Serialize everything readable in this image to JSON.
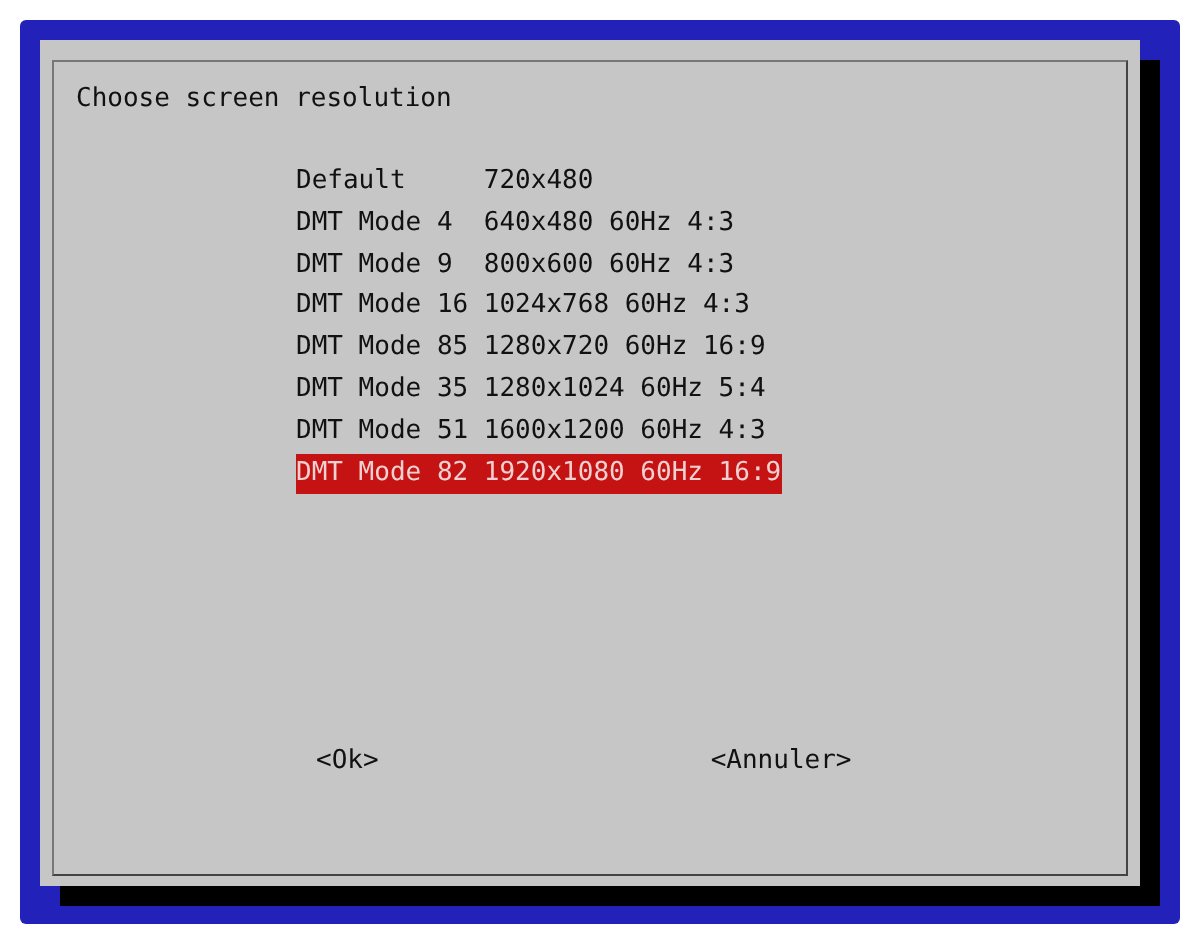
{
  "dialog": {
    "title": "Choose screen resolution",
    "items": [
      {
        "tag": "Default",
        "description": "720x480",
        "selected": false
      },
      {
        "tag": "DMT Mode 4",
        "description": "640x480 60Hz 4:3",
        "selected": false
      },
      {
        "tag": "DMT Mode 9",
        "description": "800x600 60Hz 4:3",
        "selected": false
      },
      {
        "tag": "DMT Mode 16",
        "description": "1024x768 60Hz 4:3",
        "selected": false
      },
      {
        "tag": "DMT Mode 85",
        "description": "1280x720 60Hz 16:9",
        "selected": false
      },
      {
        "tag": "DMT Mode 35",
        "description": "1280x1024 60Hz 5:4",
        "selected": false
      },
      {
        "tag": "DMT Mode 51",
        "description": "1600x1200 60Hz 4:3",
        "selected": false
      },
      {
        "tag": "DMT Mode 82",
        "description": "1920x1080 60Hz 16:9",
        "selected": true
      }
    ],
    "buttons": [
      "<Ok>",
      "<Annuler>"
    ]
  }
}
